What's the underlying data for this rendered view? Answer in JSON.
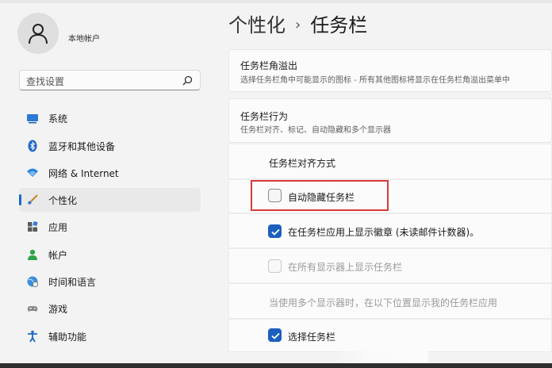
{
  "account": {
    "name": "本地帐户"
  },
  "search": {
    "placeholder": "查找设置"
  },
  "nav": [
    {
      "id": "system",
      "label": "系统",
      "icon": "monitor-icon"
    },
    {
      "id": "bluetooth",
      "label": "蓝牙和其他设备",
      "icon": "bluetooth-icon"
    },
    {
      "id": "network",
      "label": "网络 & Internet",
      "icon": "wifi-icon"
    },
    {
      "id": "personalization",
      "label": "个性化",
      "icon": "brush-icon",
      "active": true
    },
    {
      "id": "apps",
      "label": "应用",
      "icon": "apps-icon"
    },
    {
      "id": "accounts",
      "label": "帐户",
      "icon": "person-icon"
    },
    {
      "id": "time",
      "label": "时间和语言",
      "icon": "globe-clock-icon"
    },
    {
      "id": "gaming",
      "label": "游戏",
      "icon": "gamepad-icon"
    },
    {
      "id": "accessibility",
      "label": "辅助功能",
      "icon": "accessibility-icon"
    }
  ],
  "breadcrumb": {
    "parent": "个性化",
    "separator": "›",
    "current": "任务栏"
  },
  "cards": {
    "overflow": {
      "title": "任务栏角溢出",
      "subtitle": "选择任务栏角中可能显示的图标 - 所有其他图标将显示在任务栏角溢出菜单中"
    },
    "behavior": {
      "title": "任务栏行为",
      "subtitle": "任务栏对齐、标记、自动隐藏和多个显示器"
    }
  },
  "settings": {
    "alignment": "任务栏对齐方式",
    "autohide": {
      "label": "自动隐藏任务栏",
      "checked": false
    },
    "badges": {
      "label": "在任务栏应用上显示徽章 (未读邮件计数器)。",
      "checked": true
    },
    "all_displays": {
      "label": "在所有显示器上显示任务栏",
      "checked": false,
      "disabled": true
    },
    "multi_display_note": "当使用多个显示器时，在以下位置显示我的任务栏应用",
    "select_display": {
      "label": "选择任务栏",
      "checked": true
    }
  },
  "colors": {
    "accent": "#1d5fbf",
    "highlight": "#d83a3a"
  }
}
